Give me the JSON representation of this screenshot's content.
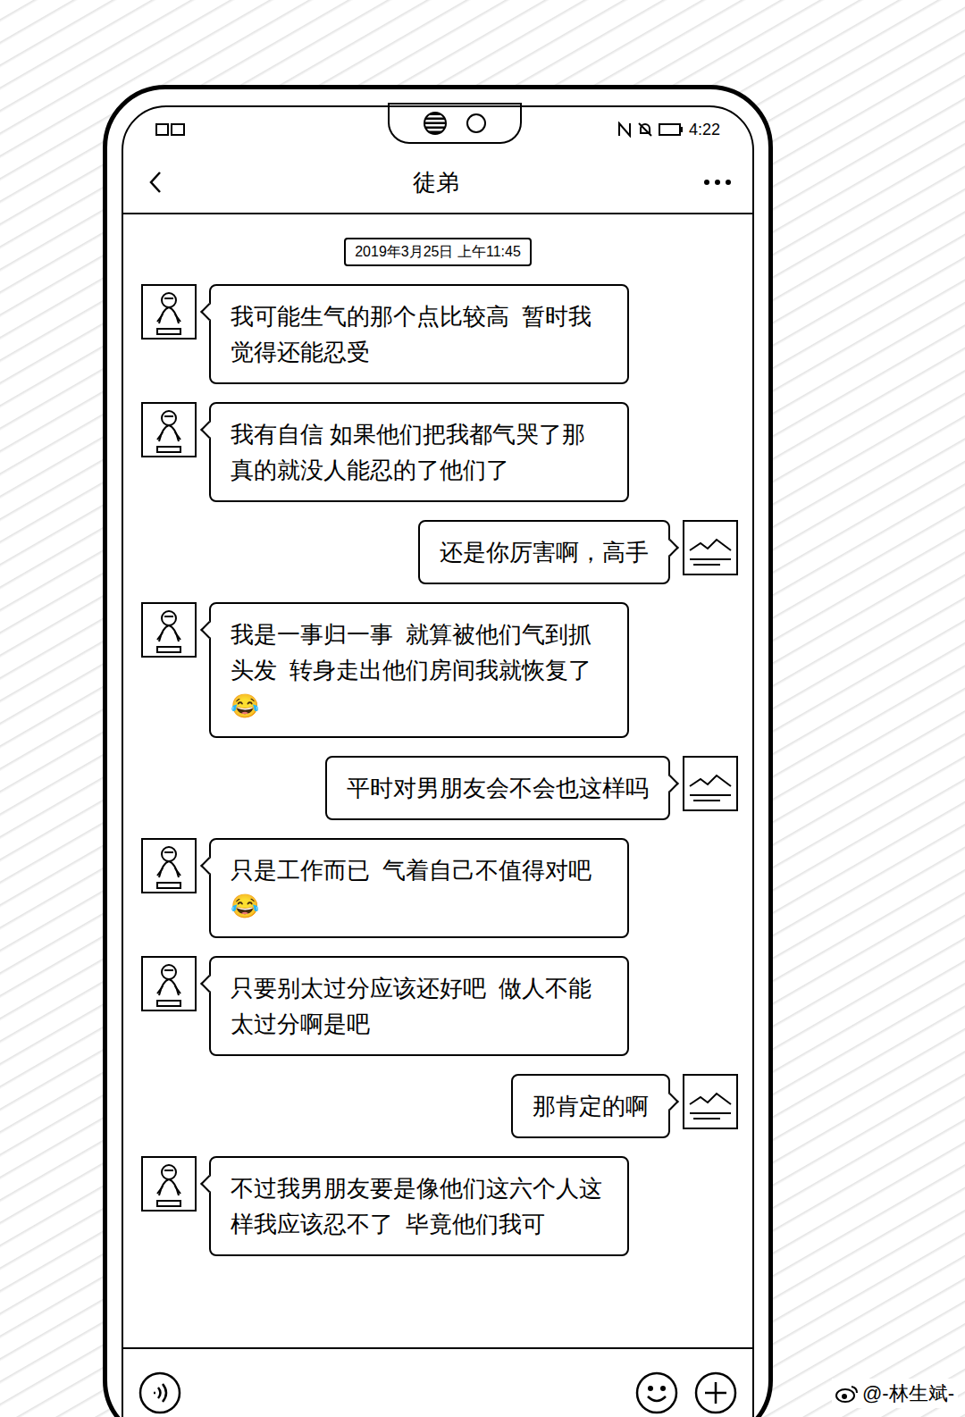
{
  "status_bar": {
    "time": "4:22"
  },
  "header": {
    "title": "徒弟"
  },
  "timestamp": "2019年3月25日 上午11:45",
  "messages": [
    {
      "kind": "received",
      "text": "我可能生气的那个点比较高  暂时我觉得还能忍受"
    },
    {
      "kind": "received",
      "text": "我有自信 如果他们把我都气哭了那真的就没人能忍的了他们了"
    },
    {
      "kind": "sent",
      "text": "还是你厉害啊，高手"
    },
    {
      "kind": "received",
      "text": "我是一事归一事  就算被他们气到抓头发  转身走出他们房间我就恢复了😂"
    },
    {
      "kind": "sent",
      "text": "平时对男朋友会不会也这样吗"
    },
    {
      "kind": "received",
      "text": "只是工作而已  气着自己不值得对吧😂"
    },
    {
      "kind": "received",
      "text": "只要别太过分应该还好吧  做人不能太过分啊是吧"
    },
    {
      "kind": "sent",
      "text": "那肯定的啊"
    },
    {
      "kind": "received",
      "text": "不过我男朋友要是像他们这六个人这样我应该忍不了  毕竟他们我可"
    }
  ],
  "watermark": "@-林生斌-"
}
